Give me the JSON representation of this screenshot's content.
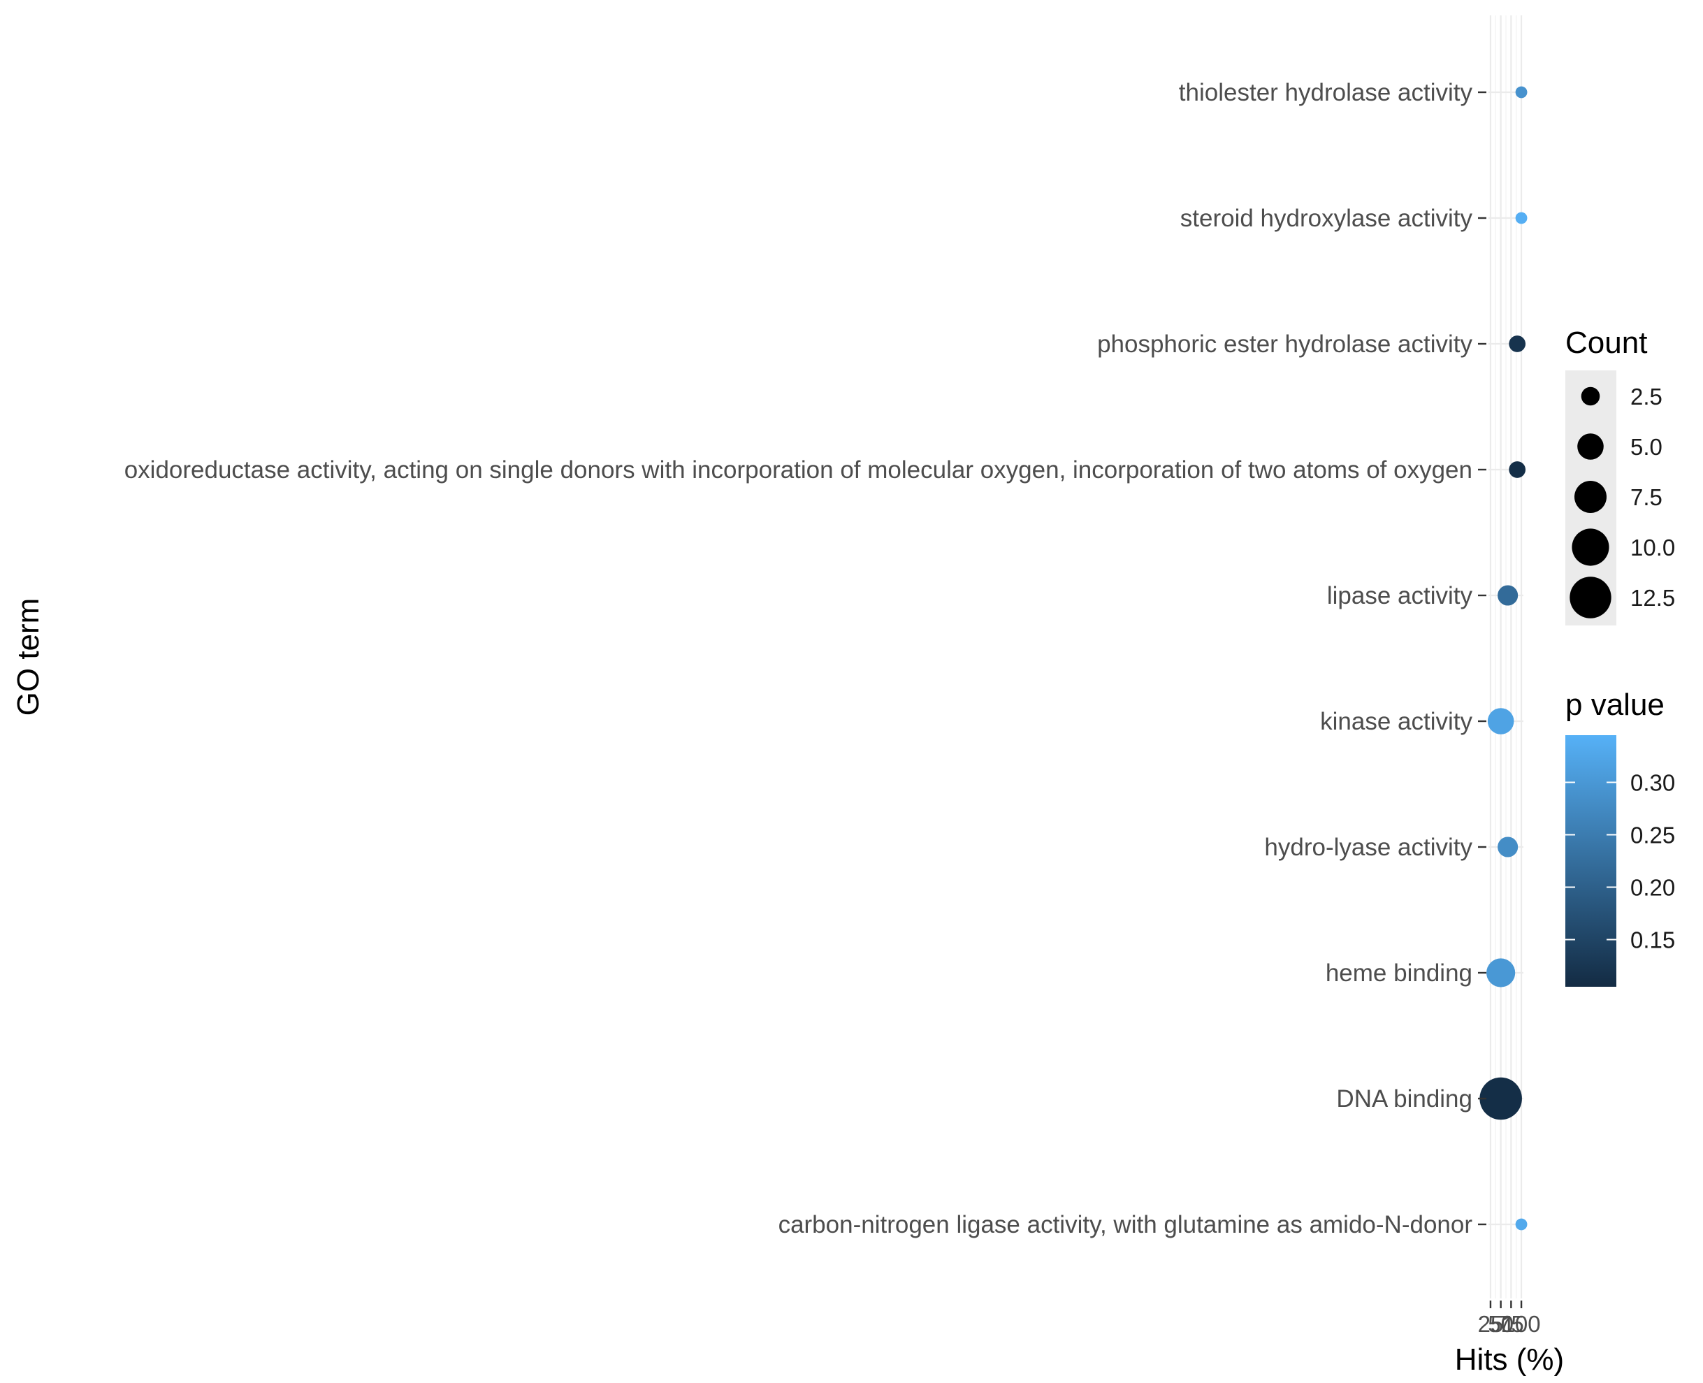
{
  "chart_data": {
    "type": "scatter",
    "xlabel": "Hits (%)",
    "ylabel": "GO term",
    "x_tick_labels": [
      "25",
      "50",
      "75",
      "100"
    ],
    "categories": [
      "carbon-nitrogen ligase activity, with glutamine as amido-N-donor",
      "DNA binding",
      "heme binding",
      "hydro-lyase activity",
      "kinase activity",
      "lipase activity",
      "oxidoreductase activity, acting on single donors with incorporation of molecular oxygen, incorporation of two atoms of oxygen",
      "phosphoric ester hydrolase activity",
      "steroid hydroxylase activity",
      "thiolester hydrolase activity"
    ],
    "points": [
      {
        "term": "carbon-nitrogen ligase activity, with glutamine as amido-N-donor",
        "hits": 100,
        "count": 1,
        "p_value": 0.33
      },
      {
        "term": "DNA binding",
        "hits": 50,
        "count": 13,
        "p_value": 0.11
      },
      {
        "term": "heme binding",
        "hits": 50,
        "count": 6,
        "p_value": 0.3
      },
      {
        "term": "hydro-lyase activity",
        "hits": 67,
        "count": 3,
        "p_value": 0.28
      },
      {
        "term": "kinase activity",
        "hits": 50,
        "count": 5,
        "p_value": 0.32
      },
      {
        "term": "lipase activity",
        "hits": 67,
        "count": 3,
        "p_value": 0.22
      },
      {
        "term": "oxidoreductase activity, acting on single donors with incorporation of molecular oxygen, incorporation of two atoms of oxygen",
        "hits": 90,
        "count": 2,
        "p_value": 0.11
      },
      {
        "term": "phosphoric ester hydrolase activity",
        "hits": 90,
        "count": 2,
        "p_value": 0.12
      },
      {
        "term": "steroid hydroxylase activity",
        "hits": 100,
        "count": 1,
        "p_value": 0.34
      },
      {
        "term": "thiolester hydrolase activity",
        "hits": 100,
        "count": 1,
        "p_value": 0.29
      }
    ],
    "xlim": [
      20,
      105
    ],
    "size_legend": {
      "title": "Count",
      "labels": [
        "2.5",
        "5.0",
        "7.5",
        "10.0",
        "12.5"
      ],
      "values": [
        2.5,
        5.0,
        7.5,
        10.0,
        12.5
      ]
    },
    "color_legend": {
      "title": "p value",
      "labels": [
        "0.15",
        "0.20",
        "0.25",
        "0.30"
      ],
      "values": [
        0.15,
        0.2,
        0.25,
        0.3
      ],
      "range": [
        0.105,
        0.345
      ],
      "low_color": "#132b43",
      "high_color": "#56b1f7"
    },
    "grid": true,
    "legend_position": "right"
  }
}
